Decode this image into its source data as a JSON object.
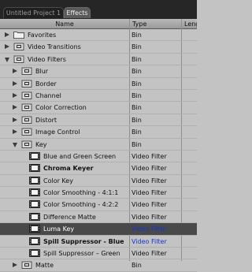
{
  "tabs": [
    {
      "label": "Untitled Project 1",
      "active": false
    },
    {
      "label": "Effects",
      "active": true
    }
  ],
  "columns": {
    "name": "Name",
    "type": "Type",
    "length": "Leng"
  },
  "colors": {
    "background": "#c3c3c3",
    "selected_row": "#494949",
    "accent_type": "#1a33d6"
  },
  "rows": [
    {
      "label": "Favorites",
      "type": "Bin",
      "indent": 0,
      "expander": "collapsed",
      "icon": "folder-icon",
      "bold": false
    },
    {
      "label": "Video Transitions",
      "type": "Bin",
      "indent": 0,
      "expander": "collapsed",
      "icon": "bin-icon",
      "bold": false
    },
    {
      "label": "Video Filters",
      "type": "Bin",
      "indent": 0,
      "expander": "expanded",
      "icon": "bin-icon",
      "bold": false
    },
    {
      "label": "Blur",
      "type": "Bin",
      "indent": 1,
      "expander": "collapsed",
      "icon": "bin-icon",
      "bold": false
    },
    {
      "label": "Border",
      "type": "Bin",
      "indent": 1,
      "expander": "collapsed",
      "icon": "bin-icon",
      "bold": false
    },
    {
      "label": "Channel",
      "type": "Bin",
      "indent": 1,
      "expander": "collapsed",
      "icon": "bin-icon",
      "bold": false
    },
    {
      "label": "Color Correction",
      "type": "Bin",
      "indent": 1,
      "expander": "collapsed",
      "icon": "bin-icon",
      "bold": false
    },
    {
      "label": "Distort",
      "type": "Bin",
      "indent": 1,
      "expander": "collapsed",
      "icon": "bin-icon",
      "bold": false
    },
    {
      "label": "Image Control",
      "type": "Bin",
      "indent": 1,
      "expander": "collapsed",
      "icon": "bin-icon",
      "bold": false
    },
    {
      "label": "Key",
      "type": "Bin",
      "indent": 1,
      "expander": "expanded",
      "icon": "bin-icon",
      "bold": false
    },
    {
      "label": "Blue and Green Screen",
      "type": "Video Filter",
      "indent": 2,
      "expander": "none",
      "icon": "filter-icon",
      "bold": false
    },
    {
      "label": "Chroma Keyer",
      "type": "Video Filter",
      "indent": 2,
      "expander": "none",
      "icon": "filter-icon",
      "bold": true
    },
    {
      "label": "Color Key",
      "type": "Video Filter",
      "indent": 2,
      "expander": "none",
      "icon": "filter-icon",
      "bold": false
    },
    {
      "label": "Color Smoothing - 4:1:1",
      "type": "Video Filter",
      "indent": 2,
      "expander": "none",
      "icon": "filter-icon",
      "bold": false
    },
    {
      "label": "Color Smoothing - 4:2:2",
      "type": "Video Filter",
      "indent": 2,
      "expander": "none",
      "icon": "filter-icon",
      "bold": false
    },
    {
      "label": "Difference Matte",
      "type": "Video Filter",
      "indent": 2,
      "expander": "none",
      "icon": "filter-icon",
      "bold": false
    },
    {
      "label": "Luma Key",
      "type": "Video Filter",
      "indent": 2,
      "expander": "none",
      "icon": "filter-icon",
      "bold": false,
      "selected": true
    },
    {
      "label": "Spill Suppressor - Blue",
      "type": "Video Filter",
      "indent": 2,
      "expander": "none",
      "icon": "filter-icon",
      "bold": true,
      "accent": true
    },
    {
      "label": "Spill Suppressor – Green",
      "type": "Video Filter",
      "indent": 2,
      "expander": "none",
      "icon": "filter-icon",
      "bold": false
    },
    {
      "label": "Matte",
      "type": "Bin",
      "indent": 1,
      "expander": "collapsed",
      "icon": "bin-icon",
      "bold": false
    }
  ]
}
